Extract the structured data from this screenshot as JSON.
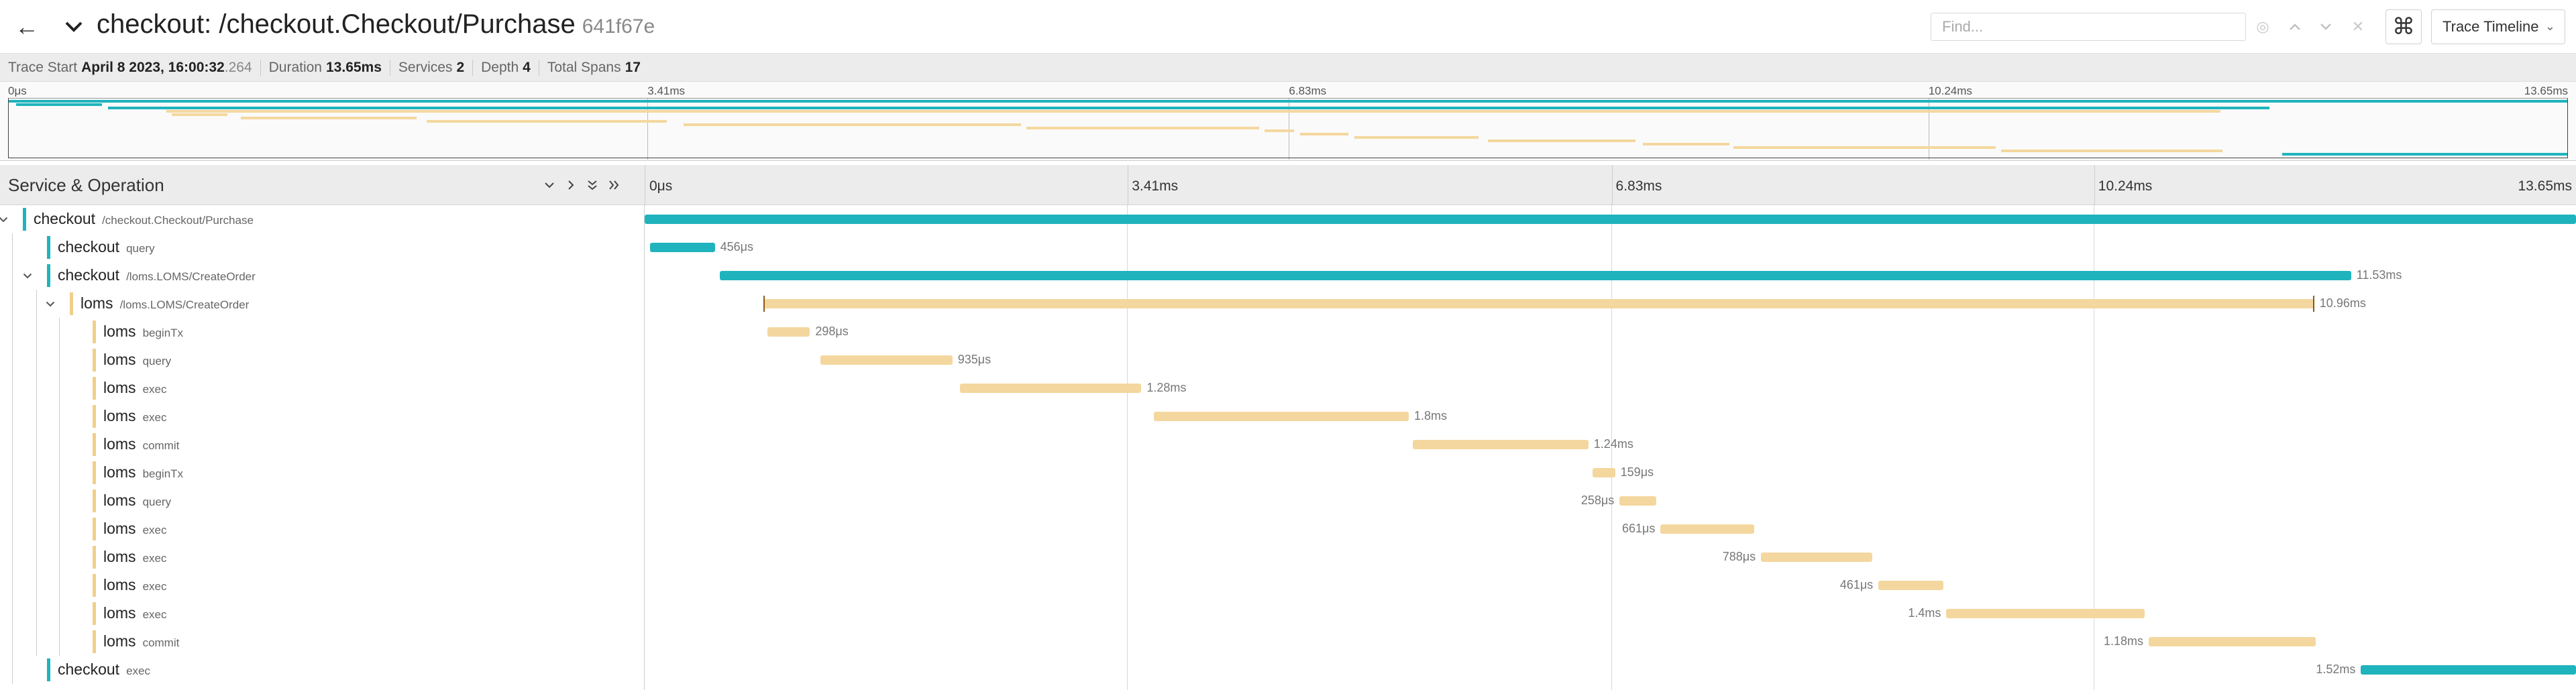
{
  "header": {
    "title": "checkout: /checkout.Checkout/Purchase",
    "trace_id": "641f67e",
    "find_placeholder": "Find...",
    "view_selector": "Trace Timeline",
    "icons": {
      "back": "arrow-left-icon",
      "collapse": "chevron-down-icon",
      "keyboard": "command-key-icon",
      "find_prev": "chevron-up-icon",
      "find_next": "chevron-down-icon",
      "find_clear": "close-icon",
      "find_locate": "locate-icon"
    }
  },
  "trace_info": {
    "start_label": "Trace Start",
    "start_value": "April 8 2023, 16:00:32",
    "start_ms": ".264",
    "duration_label": "Duration",
    "duration_value": "13.65ms",
    "services_label": "Services",
    "services_value": "2",
    "depth_label": "Depth",
    "depth_value": "4",
    "total_spans_label": "Total Spans",
    "total_spans_value": "17"
  },
  "ticks": [
    "0μs",
    "3.41ms",
    "6.83ms",
    "10.24ms",
    "13.65ms"
  ],
  "tick_values_ms": [
    0,
    3.41,
    6.83,
    10.24,
    13.65
  ],
  "total_ms": 13.65,
  "column_header": {
    "title": "Service & Operation"
  },
  "colors": {
    "checkout": "#1fb4bd",
    "loms": "#f4d79e",
    "cap": "#8a5a1c"
  },
  "spans": [
    {
      "service": "checkout",
      "operation": "/checkout.Checkout/Purchase",
      "depth": 0,
      "toggle": "down",
      "start_ms": 0.0,
      "dur_ms": 13.65,
      "label": "",
      "label_side": "right"
    },
    {
      "service": "checkout",
      "operation": "query",
      "depth": 1,
      "toggle": "",
      "start_ms": 0.04,
      "dur_ms": 0.456,
      "label": "456μs",
      "label_side": "right"
    },
    {
      "service": "checkout",
      "operation": "/loms.LOMS/CreateOrder",
      "depth": 1,
      "toggle": "down",
      "start_ms": 0.53,
      "dur_ms": 11.53,
      "label": "11.53ms",
      "label_side": "right"
    },
    {
      "service": "loms",
      "operation": "/loms.LOMS/CreateOrder",
      "depth": 2,
      "toggle": "down",
      "start_ms": 0.84,
      "dur_ms": 10.96,
      "label": "10.96ms",
      "label_side": "right"
    },
    {
      "service": "loms",
      "operation": "beginTx",
      "depth": 3,
      "toggle": "",
      "start_ms": 0.87,
      "dur_ms": 0.298,
      "label": "298μs",
      "label_side": "right"
    },
    {
      "service": "loms",
      "operation": "query",
      "depth": 3,
      "toggle": "",
      "start_ms": 1.24,
      "dur_ms": 0.935,
      "label": "935μs",
      "label_side": "right"
    },
    {
      "service": "loms",
      "operation": "exec",
      "depth": 3,
      "toggle": "",
      "start_ms": 2.23,
      "dur_ms": 1.28,
      "label": "1.28ms",
      "label_side": "right"
    },
    {
      "service": "loms",
      "operation": "exec",
      "depth": 3,
      "toggle": "",
      "start_ms": 3.6,
      "dur_ms": 1.8,
      "label": "1.8ms",
      "label_side": "right"
    },
    {
      "service": "loms",
      "operation": "commit",
      "depth": 3,
      "toggle": "",
      "start_ms": 5.43,
      "dur_ms": 1.24,
      "label": "1.24ms",
      "label_side": "right"
    },
    {
      "service": "loms",
      "operation": "beginTx",
      "depth": 3,
      "toggle": "",
      "start_ms": 6.7,
      "dur_ms": 0.159,
      "label": "159μs",
      "label_side": "right"
    },
    {
      "service": "loms",
      "operation": "query",
      "depth": 3,
      "toggle": "",
      "start_ms": 6.89,
      "dur_ms": 0.258,
      "label": "258μs",
      "label_side": "left"
    },
    {
      "service": "loms",
      "operation": "exec",
      "depth": 3,
      "toggle": "",
      "start_ms": 7.18,
      "dur_ms": 0.661,
      "label": "661μs",
      "label_side": "left"
    },
    {
      "service": "loms",
      "operation": "exec",
      "depth": 3,
      "toggle": "",
      "start_ms": 7.89,
      "dur_ms": 0.788,
      "label": "788μs",
      "label_side": "left"
    },
    {
      "service": "loms",
      "operation": "exec",
      "depth": 3,
      "toggle": "",
      "start_ms": 8.72,
      "dur_ms": 0.461,
      "label": "461μs",
      "label_side": "left"
    },
    {
      "service": "loms",
      "operation": "exec",
      "depth": 3,
      "toggle": "",
      "start_ms": 9.2,
      "dur_ms": 1.4,
      "label": "1.4ms",
      "label_side": "left"
    },
    {
      "service": "loms",
      "operation": "commit",
      "depth": 3,
      "toggle": "",
      "start_ms": 10.63,
      "dur_ms": 1.18,
      "label": "1.18ms",
      "label_side": "left"
    },
    {
      "service": "checkout",
      "operation": "exec",
      "depth": 1,
      "toggle": "",
      "start_ms": 12.13,
      "dur_ms": 1.52,
      "label": "1.52ms",
      "label_side": "left"
    }
  ]
}
